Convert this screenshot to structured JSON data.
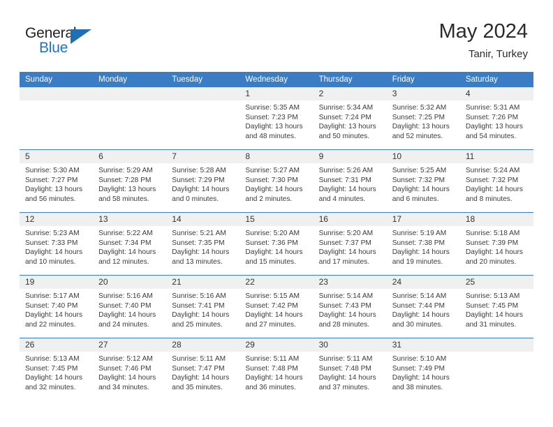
{
  "logo": {
    "word1": "General",
    "word2": "Blue",
    "triangle_color": "#1e6fb5",
    "text_color": "#231f20",
    "blue_color": "#1d76bf"
  },
  "header": {
    "title": "May 2024",
    "subtitle": "Tanir, Turkey",
    "header_bg": "#3b7dc4",
    "band_bg": "#f0f0f0"
  },
  "weekdays": [
    "Sunday",
    "Monday",
    "Tuesday",
    "Wednesday",
    "Thursday",
    "Friday",
    "Saturday"
  ],
  "weeks": [
    [
      {
        "day": "",
        "empty": true
      },
      {
        "day": "",
        "empty": true
      },
      {
        "day": "",
        "empty": true
      },
      {
        "day": "1",
        "sunrise": "Sunrise: 5:35 AM",
        "sunset": "Sunset: 7:23 PM",
        "daylight_1": "Daylight: 13 hours",
        "daylight_2": "and 48 minutes."
      },
      {
        "day": "2",
        "sunrise": "Sunrise: 5:34 AM",
        "sunset": "Sunset: 7:24 PM",
        "daylight_1": "Daylight: 13 hours",
        "daylight_2": "and 50 minutes."
      },
      {
        "day": "3",
        "sunrise": "Sunrise: 5:32 AM",
        "sunset": "Sunset: 7:25 PM",
        "daylight_1": "Daylight: 13 hours",
        "daylight_2": "and 52 minutes."
      },
      {
        "day": "4",
        "sunrise": "Sunrise: 5:31 AM",
        "sunset": "Sunset: 7:26 PM",
        "daylight_1": "Daylight: 13 hours",
        "daylight_2": "and 54 minutes."
      }
    ],
    [
      {
        "day": "5",
        "sunrise": "Sunrise: 5:30 AM",
        "sunset": "Sunset: 7:27 PM",
        "daylight_1": "Daylight: 13 hours",
        "daylight_2": "and 56 minutes."
      },
      {
        "day": "6",
        "sunrise": "Sunrise: 5:29 AM",
        "sunset": "Sunset: 7:28 PM",
        "daylight_1": "Daylight: 13 hours",
        "daylight_2": "and 58 minutes."
      },
      {
        "day": "7",
        "sunrise": "Sunrise: 5:28 AM",
        "sunset": "Sunset: 7:29 PM",
        "daylight_1": "Daylight: 14 hours",
        "daylight_2": "and 0 minutes."
      },
      {
        "day": "8",
        "sunrise": "Sunrise: 5:27 AM",
        "sunset": "Sunset: 7:30 PM",
        "daylight_1": "Daylight: 14 hours",
        "daylight_2": "and 2 minutes."
      },
      {
        "day": "9",
        "sunrise": "Sunrise: 5:26 AM",
        "sunset": "Sunset: 7:31 PM",
        "daylight_1": "Daylight: 14 hours",
        "daylight_2": "and 4 minutes."
      },
      {
        "day": "10",
        "sunrise": "Sunrise: 5:25 AM",
        "sunset": "Sunset: 7:32 PM",
        "daylight_1": "Daylight: 14 hours",
        "daylight_2": "and 6 minutes."
      },
      {
        "day": "11",
        "sunrise": "Sunrise: 5:24 AM",
        "sunset": "Sunset: 7:32 PM",
        "daylight_1": "Daylight: 14 hours",
        "daylight_2": "and 8 minutes."
      }
    ],
    [
      {
        "day": "12",
        "sunrise": "Sunrise: 5:23 AM",
        "sunset": "Sunset: 7:33 PM",
        "daylight_1": "Daylight: 14 hours",
        "daylight_2": "and 10 minutes."
      },
      {
        "day": "13",
        "sunrise": "Sunrise: 5:22 AM",
        "sunset": "Sunset: 7:34 PM",
        "daylight_1": "Daylight: 14 hours",
        "daylight_2": "and 12 minutes."
      },
      {
        "day": "14",
        "sunrise": "Sunrise: 5:21 AM",
        "sunset": "Sunset: 7:35 PM",
        "daylight_1": "Daylight: 14 hours",
        "daylight_2": "and 13 minutes."
      },
      {
        "day": "15",
        "sunrise": "Sunrise: 5:20 AM",
        "sunset": "Sunset: 7:36 PM",
        "daylight_1": "Daylight: 14 hours",
        "daylight_2": "and 15 minutes."
      },
      {
        "day": "16",
        "sunrise": "Sunrise: 5:20 AM",
        "sunset": "Sunset: 7:37 PM",
        "daylight_1": "Daylight: 14 hours",
        "daylight_2": "and 17 minutes."
      },
      {
        "day": "17",
        "sunrise": "Sunrise: 5:19 AM",
        "sunset": "Sunset: 7:38 PM",
        "daylight_1": "Daylight: 14 hours",
        "daylight_2": "and 19 minutes."
      },
      {
        "day": "18",
        "sunrise": "Sunrise: 5:18 AM",
        "sunset": "Sunset: 7:39 PM",
        "daylight_1": "Daylight: 14 hours",
        "daylight_2": "and 20 minutes."
      }
    ],
    [
      {
        "day": "19",
        "sunrise": "Sunrise: 5:17 AM",
        "sunset": "Sunset: 7:40 PM",
        "daylight_1": "Daylight: 14 hours",
        "daylight_2": "and 22 minutes."
      },
      {
        "day": "20",
        "sunrise": "Sunrise: 5:16 AM",
        "sunset": "Sunset: 7:40 PM",
        "daylight_1": "Daylight: 14 hours",
        "daylight_2": "and 24 minutes."
      },
      {
        "day": "21",
        "sunrise": "Sunrise: 5:16 AM",
        "sunset": "Sunset: 7:41 PM",
        "daylight_1": "Daylight: 14 hours",
        "daylight_2": "and 25 minutes."
      },
      {
        "day": "22",
        "sunrise": "Sunrise: 5:15 AM",
        "sunset": "Sunset: 7:42 PM",
        "daylight_1": "Daylight: 14 hours",
        "daylight_2": "and 27 minutes."
      },
      {
        "day": "23",
        "sunrise": "Sunrise: 5:14 AM",
        "sunset": "Sunset: 7:43 PM",
        "daylight_1": "Daylight: 14 hours",
        "daylight_2": "and 28 minutes."
      },
      {
        "day": "24",
        "sunrise": "Sunrise: 5:14 AM",
        "sunset": "Sunset: 7:44 PM",
        "daylight_1": "Daylight: 14 hours",
        "daylight_2": "and 30 minutes."
      },
      {
        "day": "25",
        "sunrise": "Sunrise: 5:13 AM",
        "sunset": "Sunset: 7:45 PM",
        "daylight_1": "Daylight: 14 hours",
        "daylight_2": "and 31 minutes."
      }
    ],
    [
      {
        "day": "26",
        "sunrise": "Sunrise: 5:13 AM",
        "sunset": "Sunset: 7:45 PM",
        "daylight_1": "Daylight: 14 hours",
        "daylight_2": "and 32 minutes."
      },
      {
        "day": "27",
        "sunrise": "Sunrise: 5:12 AM",
        "sunset": "Sunset: 7:46 PM",
        "daylight_1": "Daylight: 14 hours",
        "daylight_2": "and 34 minutes."
      },
      {
        "day": "28",
        "sunrise": "Sunrise: 5:11 AM",
        "sunset": "Sunset: 7:47 PM",
        "daylight_1": "Daylight: 14 hours",
        "daylight_2": "and 35 minutes."
      },
      {
        "day": "29",
        "sunrise": "Sunrise: 5:11 AM",
        "sunset": "Sunset: 7:48 PM",
        "daylight_1": "Daylight: 14 hours",
        "daylight_2": "and 36 minutes."
      },
      {
        "day": "30",
        "sunrise": "Sunrise: 5:11 AM",
        "sunset": "Sunset: 7:48 PM",
        "daylight_1": "Daylight: 14 hours",
        "daylight_2": "and 37 minutes."
      },
      {
        "day": "31",
        "sunrise": "Sunrise: 5:10 AM",
        "sunset": "Sunset: 7:49 PM",
        "daylight_1": "Daylight: 14 hours",
        "daylight_2": "and 38 minutes."
      },
      {
        "day": "",
        "empty": true
      }
    ]
  ]
}
